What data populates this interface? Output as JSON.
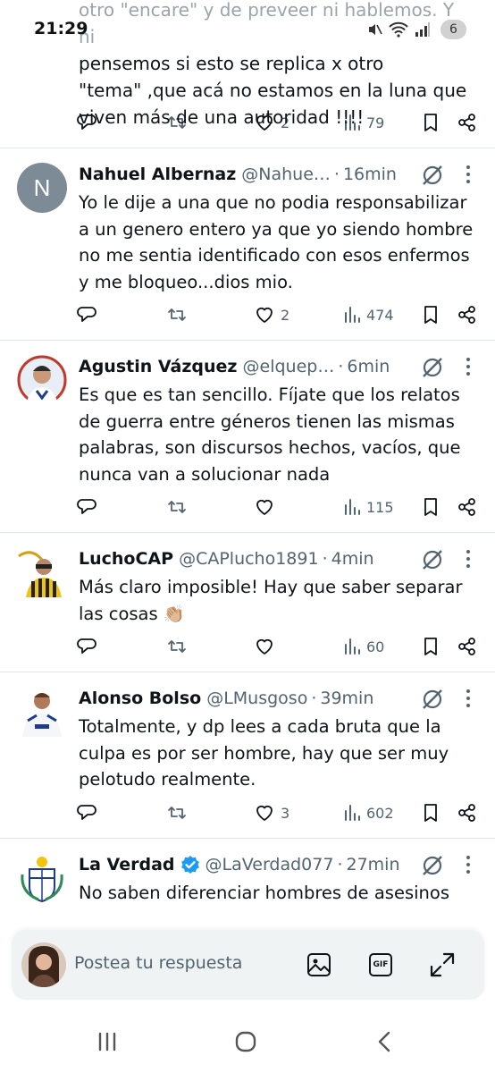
{
  "status_bar": {
    "time": "21:29",
    "battery": "6"
  },
  "partial_tweet": {
    "lines": [
      "otro \"encare\" y de preveer ni hablemos. Y ni",
      "pensemos si esto se replica x otro",
      "\"tema\" ,que acá no estamos en la luna que",
      "viven más de una autoridad !!!!"
    ],
    "likes": "2",
    "views": "79"
  },
  "tweets": [
    {
      "name": "Nahuel Albernaz",
      "handle": "@Nahue…",
      "time": "16min",
      "avatar_letter": "N",
      "body": "Yo le dije a una que no podia responsabilizar a un genero entero ya que yo siendo hombre no me sentia identificado con esos enfermos y me bloqueo...dios mio.",
      "replies": "",
      "retweets": "",
      "likes": "2",
      "views": "474"
    },
    {
      "name": "Agustin Vázquez",
      "handle": "@elquep…",
      "time": "6min",
      "body": "Es que es tan sencillo. Fíjate que los relatos de guerra entre géneros tienen las mismas palabras, son discursos hechos, vacíos, que nunca van a solucionar nada",
      "replies": "",
      "retweets": "",
      "likes": "",
      "views": "115"
    },
    {
      "name": "LuchoCAP",
      "handle": "@CAPlucho1891",
      "time": "4min",
      "body": "Más claro imposible! Hay que saber separar las cosas 👏🏼",
      "replies": "",
      "retweets": "",
      "likes": "",
      "views": "60"
    },
    {
      "name": "Alonso Bolso",
      "handle": "@LMusgoso",
      "time": "39min",
      "body": "Totalmente, y dp lees a cada bruta que la culpa es por ser hombre, hay que ser muy pelotudo realmente.",
      "replies": "",
      "retweets": "",
      "likes": "3",
      "views": "602"
    },
    {
      "name": "La Verdad",
      "handle": "@LaVerdad077",
      "time": "27min",
      "body": "No saben diferenciar hombres de asesinos",
      "verified": true
    }
  ],
  "composer": {
    "placeholder": "Postea tu respuesta",
    "gif_label": "GIF"
  },
  "separator": "·",
  "icons": [
    "reply-icon",
    "retweet-icon",
    "like-icon",
    "views-icon",
    "bookmark-icon",
    "share-icon",
    "grok-icon",
    "more-icon",
    "image-icon",
    "gif-icon",
    "expand-icon",
    "recents-icon",
    "home-icon",
    "back-icon"
  ],
  "colors": {
    "text": "#0f1419",
    "secondary": "#536471",
    "divider": "#e1e6ea",
    "composer_bg": "#eff3f4",
    "verified": "#1d9bf0"
  }
}
